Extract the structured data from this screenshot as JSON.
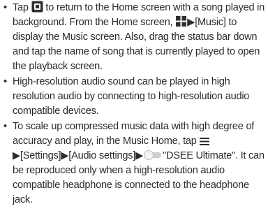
{
  "bullets": [
    {
      "symbol": "•",
      "t1": "Tap ",
      "icon1": "home-button-icon",
      "t2": " to return to the Home screen with a song played in background. From the Home screen, ",
      "icon2": "apps-grid-icon",
      "t3": "▶[Music] to display the Music screen. Also, drag the status bar down and tap the name of song that is currently played to open the playback screen."
    },
    {
      "symbol": "•",
      "text": "High-resolution audio sound can be played in high resolution audio by connecting to high-resolution audio compatible devices."
    },
    {
      "symbol": "•",
      "t1": "To scale up compressed music data with high degree of accuracy and play, in the Music Home, tap ",
      "icon1": "menu-lines-icon",
      "t2": "▶[Settings]▶[Audio settings]▶",
      "icon2": "toggle-switch-icon",
      "t3": "\"DSEE Ultimate\". It can be reproduced only when a high-resolution audio compatible headphone is connected to the headphone jack."
    }
  ]
}
